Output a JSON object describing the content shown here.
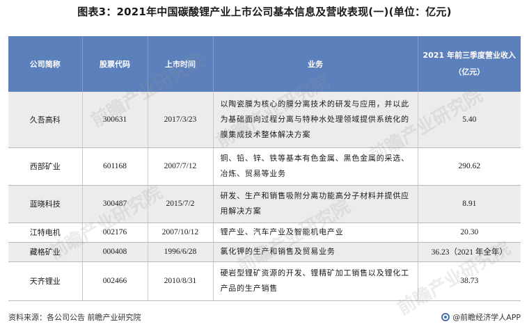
{
  "title": "图表3：2021年中国碳酸锂产业上市公司基本信息及营收表现(一)(单位：亿元)",
  "headers": [
    "公司简称",
    "股票代码",
    "上市时间",
    "业务",
    "2021 年前三季度营业收入（亿元）"
  ],
  "rows": [
    {
      "name": "久吾高科",
      "code": "300631",
      "date": "2017/3/23",
      "business": "以陶瓷膜为核心的膜分离技术的研发与应用，并以此为基础面向过程分离与特种水处理领域提供系统化的膜集成技术整体解决方案",
      "revenue": "5.40"
    },
    {
      "name": "西部矿业",
      "code": "601168",
      "date": "2007/7/12",
      "business": "铜、铅、锌、铁等基本有色金属、黑色金属的采选、冶炼、贸易等业务",
      "revenue": "290.62"
    },
    {
      "name": "蓝晓科技",
      "code": "300487",
      "date": "2015/7/2",
      "business": "研发、生产和销售吸附分离功能高分子材料并提供应用解决方案",
      "revenue": "8.91"
    },
    {
      "name": "江特电机",
      "code": "002176",
      "date": "2007/10/12",
      "business": "锂产业、汽车产业及智能机电产业",
      "revenue": "20.30"
    },
    {
      "name": "藏格矿业",
      "code": "000408",
      "date": "1996/6/28",
      "business": "氯化钾的生产和销售及贸易业务",
      "revenue": "36.23（2021 年全年）"
    },
    {
      "name": "天齐锂业",
      "code": "002466",
      "date": "2010/8/31",
      "business": "硬岩型锂矿资源的开发、锂精矿加工销售以及锂化工产品的生产销售",
      "revenue": "38.73"
    }
  ],
  "footer": {
    "source": "资料来源：各公司公告 前瞻产业研究院",
    "brand": "@前瞻经济学人APP"
  },
  "watermark": "前瞻产业研究院"
}
